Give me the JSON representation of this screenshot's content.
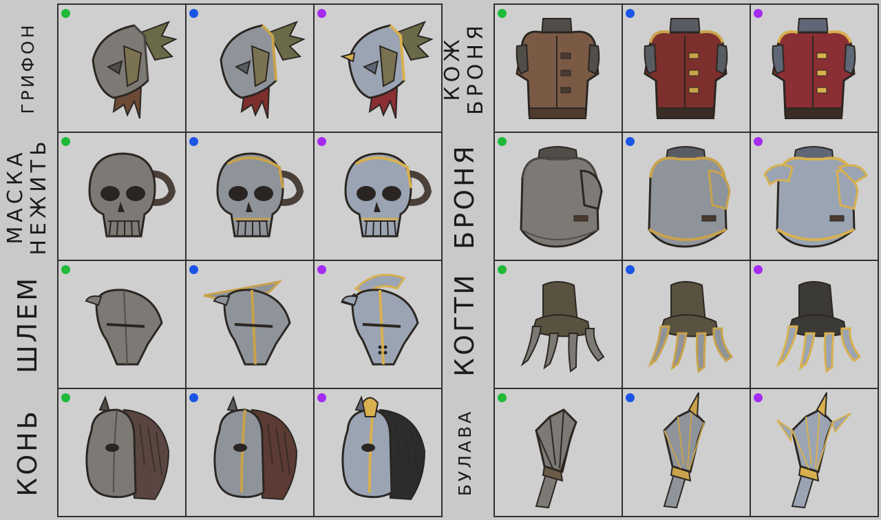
{
  "rarity_colors": {
    "common": "#1fba3a",
    "rare": "#1b55e6",
    "epic": "#a52bf0"
  },
  "left_labels": [
    {
      "lines": [
        "ГРИФОН"
      ]
    },
    {
      "lines": [
        "МАСКА",
        "НЕЖИТЬ"
      ]
    },
    {
      "lines": [
        "ШЛЕМ"
      ]
    },
    {
      "lines": [
        "КОНЬ"
      ]
    }
  ],
  "right_labels": [
    {
      "lines": [
        "КОЖ",
        "БРОНЯ"
      ]
    },
    {
      "lines": [
        "БРОНЯ"
      ]
    },
    {
      "lines": [
        "КОГТИ"
      ]
    },
    {
      "lines": [
        "БУЛАВА"
      ]
    }
  ],
  "left_rows": [
    {
      "item": "griffon-helmet",
      "icon": "griffon-helmet-icon",
      "tiers": [
        "common",
        "rare",
        "epic"
      ]
    },
    {
      "item": "undead-mask",
      "icon": "skull-mask-icon",
      "tiers": [
        "common",
        "rare",
        "epic"
      ]
    },
    {
      "item": "helmet",
      "icon": "helmet-icon",
      "tiers": [
        "common",
        "rare",
        "epic"
      ]
    },
    {
      "item": "horse-helm",
      "icon": "horse-helm-icon",
      "tiers": [
        "common",
        "rare",
        "epic"
      ]
    }
  ],
  "right_rows": [
    {
      "item": "leather-armor",
      "icon": "leather-vest-icon",
      "tiers": [
        "common",
        "rare",
        "epic"
      ]
    },
    {
      "item": "plate-armor",
      "icon": "breastplate-icon",
      "tiers": [
        "common",
        "rare",
        "epic"
      ]
    },
    {
      "item": "claws",
      "icon": "claws-icon",
      "tiers": [
        "common",
        "rare",
        "epic"
      ]
    },
    {
      "item": "mace",
      "icon": "mace-icon",
      "tiers": [
        "common",
        "rare",
        "epic"
      ]
    }
  ]
}
